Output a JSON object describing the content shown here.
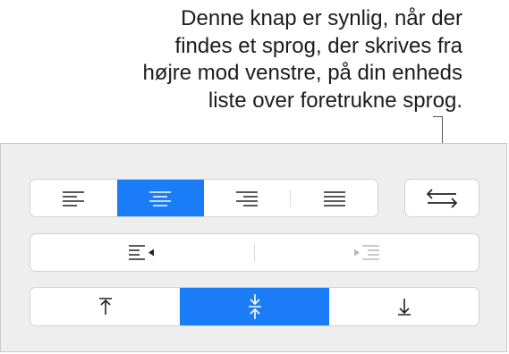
{
  "callout": {
    "lines": [
      "Denne knap er synlig, når der",
      "findes et sprog, der skrives fra",
      "højre mod venstre, på din enheds",
      "liste over foretrukne sprog."
    ]
  },
  "alignment": {
    "buttons": [
      {
        "icon": "align-left-icon",
        "selected": false
      },
      {
        "icon": "align-center-icon",
        "selected": true
      },
      {
        "icon": "align-right-icon",
        "selected": false
      },
      {
        "icon": "justify-icon",
        "selected": false
      }
    ]
  },
  "direction_button": {
    "icon": "text-direction-icon"
  },
  "indent": {
    "buttons": [
      {
        "icon": "decrease-indent-icon",
        "enabled": true
      },
      {
        "icon": "increase-indent-icon",
        "enabled": false
      }
    ]
  },
  "vertical_alignment": {
    "buttons": [
      {
        "icon": "align-top-icon",
        "selected": false
      },
      {
        "icon": "align-middle-icon",
        "selected": true
      },
      {
        "icon": "align-bottom-icon",
        "selected": false
      }
    ]
  },
  "colors": {
    "accent": "#1a7cf6",
    "panel_bg": "#eeeeee",
    "icon": "#222222",
    "icon_disabled": "#b8b8b8"
  }
}
